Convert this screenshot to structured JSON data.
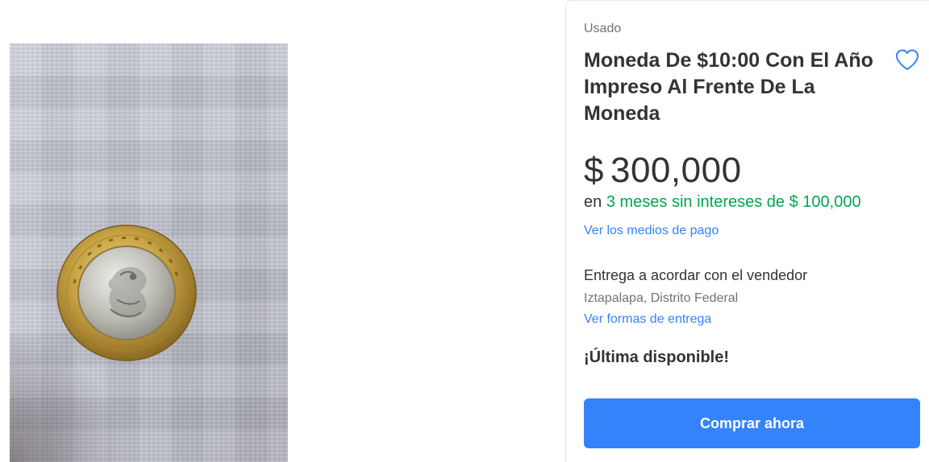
{
  "product": {
    "condition": "Usado",
    "title": "Moneda De $10:00 Con El Año Impreso Al Frente De La Moneda",
    "price_currency": "$",
    "price_amount": "300,000",
    "installments_prefix": "en",
    "installments_offer": "3 meses sin intereses de $ 100,000",
    "payment_methods_link": "Ver los medios de pago",
    "delivery_text": "Entrega a acordar con el vendedor",
    "location": "Iztapalapa, Distrito Federal",
    "shipping_link": "Ver formas de entrega",
    "stock_text": "¡Última disponible!",
    "buy_button": "Comprar ahora"
  },
  "icons": {
    "favorite": "heart-icon"
  },
  "colors": {
    "accent_blue": "#3483fa",
    "offer_green": "#00a650",
    "text_primary": "#333333",
    "text_secondary": "#737373"
  }
}
